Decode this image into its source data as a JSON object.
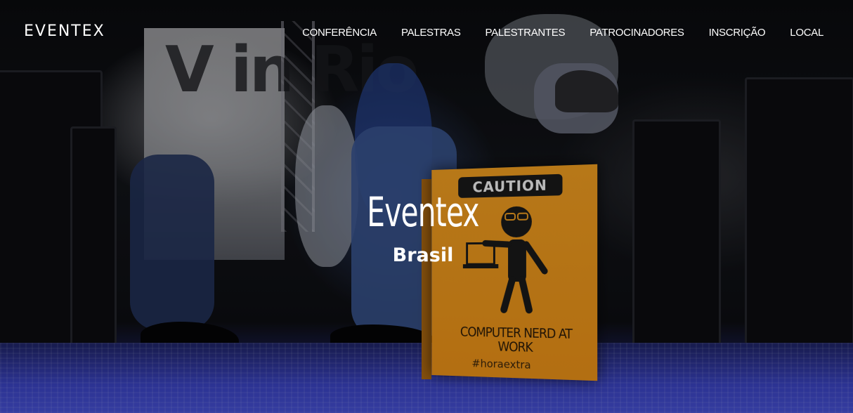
{
  "brand": {
    "name": "EVENTEX"
  },
  "nav": {
    "items": [
      {
        "label": "CONFERÊNCIA"
      },
      {
        "label": "PALESTRAS"
      },
      {
        "label": "PALESTRANTES"
      },
      {
        "label": "PATROCINADORES"
      },
      {
        "label": "INSCRIÇÃO"
      },
      {
        "label": "LOCAL"
      }
    ]
  },
  "hero": {
    "title": "Eventex",
    "subtitle": "Brasil",
    "background": {
      "banner_text": "V in Rio",
      "sign": {
        "header": "CAUTION",
        "text": "COMPUTER NERD AT WORK",
        "tag": "#horaextra"
      }
    }
  },
  "colors": {
    "text": "#ffffff",
    "sign_orange": "#f4a021",
    "carpet_blue": "#3b44c4"
  }
}
